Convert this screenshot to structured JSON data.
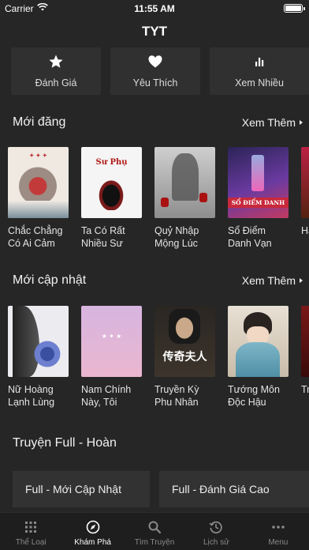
{
  "status_bar": {
    "carrier": "Carrier",
    "time": "11:55 AM"
  },
  "nav": {
    "title": "TYT"
  },
  "quick_actions": [
    {
      "label": "Đánh Giá",
      "icon": "star-icon"
    },
    {
      "label": "Yêu Thích",
      "icon": "heart-icon"
    },
    {
      "label": "Xem Nhiều",
      "icon": "bar-chart-icon"
    }
  ],
  "section_new": {
    "title": "Mới đăng",
    "more": "Xem Thêm",
    "books": [
      {
        "name": "Chắc Chẳng Có Ai Cảm T...",
        "cover_text": "",
        "cover_bg": "#f0ece6"
      },
      {
        "name": "Ta Có Rất Nhiều Sư Phụ",
        "cover_text": "",
        "cover_bg": "#f4f4f4"
      },
      {
        "name": "Quỷ Nhập Mộng Lúc N...",
        "cover_text": "",
        "cover_bg": "#b9b9b9"
      },
      {
        "name": "Sổ Điểm Danh Vạn Giới",
        "cover_text": "SỔ ĐIỂM DANH",
        "cover_bg": "#3a2d6a"
      },
      {
        "name": "Hả Điể",
        "cover_text": "",
        "cover_bg": "#7a2a2a"
      }
    ]
  },
  "section_updated": {
    "title": "Mới cập nhật",
    "more": "Xem Thêm",
    "books": [
      {
        "name": "Nữ Hoàng Lạnh Lùng",
        "cover_text": "",
        "cover_bg": "#e8e8ee"
      },
      {
        "name": "Nam Chính Này, Tôi Khô...",
        "cover_text": "",
        "cover_bg": "#e3b7d8"
      },
      {
        "name": "Truyền Kỳ Phu Nhân",
        "cover_text": "传奇夫人",
        "cover_bg": "#2e2a26"
      },
      {
        "name": "Tướng Môn Độc Hậu",
        "cover_text": "",
        "cover_bg": "#d8cfc2"
      },
      {
        "name": "Tro",
        "cover_text": "",
        "cover_bg": "#6a1414"
      }
    ]
  },
  "full_section": {
    "title": "Truyện Full - Hoàn",
    "buttons": [
      "Full - Mới Cập Nhật",
      "Full - Đánh Giá Cao"
    ]
  },
  "tabbar": {
    "active_index": 1,
    "tabs": [
      {
        "label": "Thể Loại",
        "icon": "grid-icon"
      },
      {
        "label": "Khám Phá",
        "icon": "compass-icon"
      },
      {
        "label": "Tìm Truyện",
        "icon": "search-icon"
      },
      {
        "label": "Lịch sử",
        "icon": "history-icon"
      },
      {
        "label": "Menu",
        "icon": "more-dots-icon"
      }
    ]
  },
  "colors": {
    "background": "#262626",
    "card": "#303030",
    "tabbar": "#1e1e1e",
    "active_tab": "#ffffff",
    "inactive_tab": "#8a8a8a"
  }
}
